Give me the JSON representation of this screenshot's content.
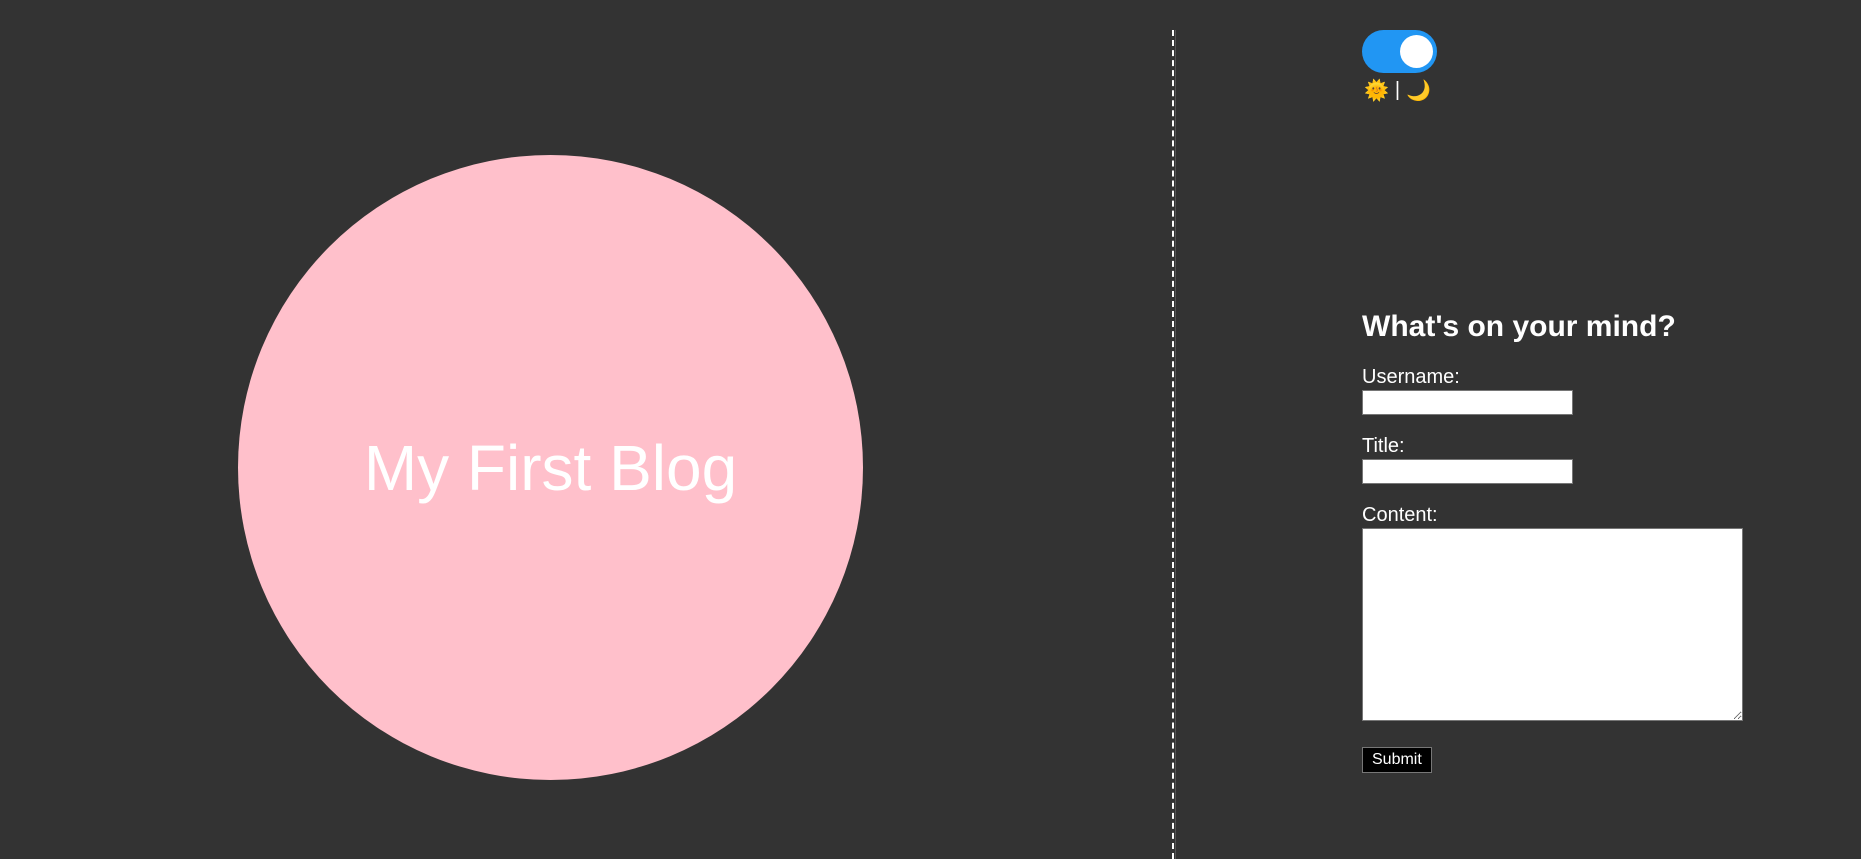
{
  "hero": {
    "title": "My First Blog",
    "circle_color": "#ffc0cb"
  },
  "theme_toggle": {
    "state": "on",
    "accent_color": "#2196f3",
    "sun_icon": "🌞",
    "separator": "|",
    "moon_icon": "🌙"
  },
  "form": {
    "heading": "What's on your mind?",
    "username_label": "Username:",
    "username_value": "",
    "title_label": "Title:",
    "title_value": "",
    "content_label": "Content:",
    "content_value": "",
    "submit_label": "Submit"
  },
  "colors": {
    "background": "#333333",
    "text": "#ffffff",
    "button_bg": "#000000"
  }
}
